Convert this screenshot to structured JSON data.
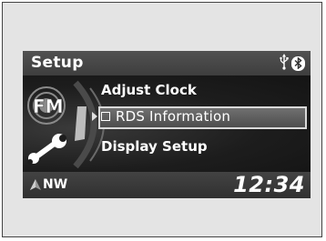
{
  "header": {
    "title": "Setup"
  },
  "status": {
    "usb_icon": "usb-icon",
    "bluetooth_icon": "bluetooth-icon"
  },
  "menu": {
    "items": [
      {
        "label": "Adjust Clock"
      },
      {
        "label": "RDS Information",
        "selected": true,
        "checkbox": false
      },
      {
        "label": "Display Setup"
      }
    ]
  },
  "graphics": {
    "fm_icon": "fm-radio-icon",
    "wrench_icon": "wrench-icon"
  },
  "footer": {
    "compass": "NW",
    "compass_icon": "compass-arrow-icon",
    "time": "12:34"
  },
  "colors": {
    "highlight_border": "#d9d9d9",
    "text": "#ffffff",
    "background": "#1a1a1a"
  }
}
